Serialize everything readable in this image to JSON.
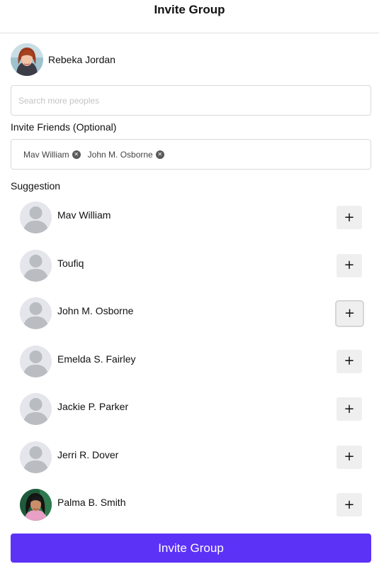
{
  "header": {
    "title": "Invite Group"
  },
  "current_user": {
    "name": "Rebeka Jordan"
  },
  "search": {
    "placeholder": "Search more peoples"
  },
  "invite_friends": {
    "label": "Invite Friends (Optional)",
    "tags": [
      "Mav William",
      "John M. Osborne"
    ],
    "remove_icon": "close-icon"
  },
  "suggestion": {
    "label": "Suggestion",
    "items": [
      {
        "name": "Mav William",
        "avatar": "default-avatar"
      },
      {
        "name": "Toufiq",
        "avatar": "default-avatar"
      },
      {
        "name": "John M. Osborne",
        "avatar": "default-avatar"
      },
      {
        "name": "Emelda S. Fairley",
        "avatar": "default-avatar"
      },
      {
        "name": "Jackie P. Parker",
        "avatar": "default-avatar"
      },
      {
        "name": "Jerri R. Dover",
        "avatar": "default-avatar"
      },
      {
        "name": "Palma B. Smith",
        "avatar": "photo"
      }
    ],
    "add_label": "+"
  },
  "footer": {
    "invite_button": "Invite Group"
  },
  "colors": {
    "accent": "#5c32f7",
    "border": "#d9d9d9",
    "add_button_bg": "#efefef",
    "placeholder_avatar": "#e4e6eb"
  }
}
